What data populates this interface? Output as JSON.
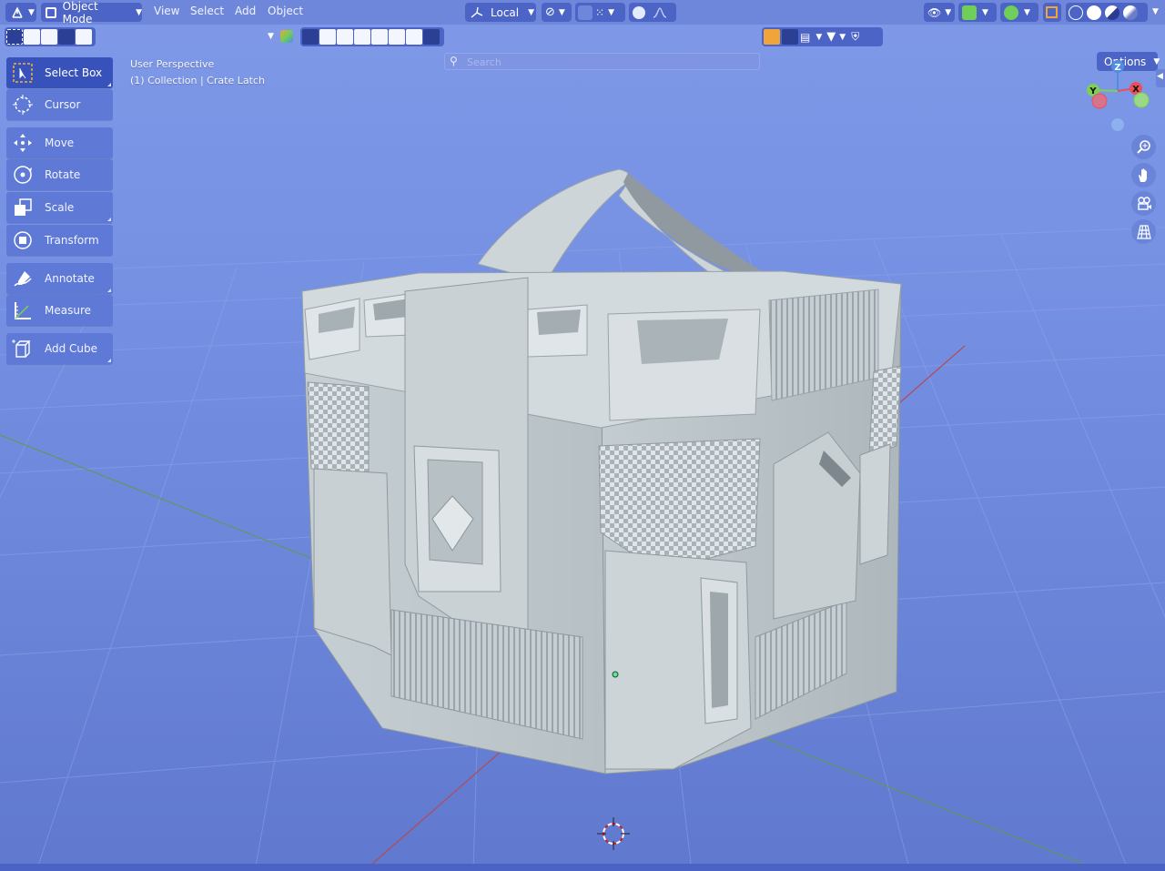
{
  "header": {
    "editor_type_icon": "viewport-axes-icon",
    "mode": "Object Mode",
    "menus": [
      "View",
      "Select",
      "Add",
      "Object"
    ],
    "transform_orientation": "Local",
    "options_label": "Options"
  },
  "toolbar_row": {
    "search_placeholder": "Search"
  },
  "tools": [
    {
      "label": "Select Box",
      "icon": "select-box-icon",
      "active": true
    },
    {
      "label": "Cursor",
      "icon": "cursor-icon"
    },
    {
      "label": "Move",
      "icon": "move-icon"
    },
    {
      "label": "Rotate",
      "icon": "rotate-icon"
    },
    {
      "label": "Scale",
      "icon": "scale-icon"
    },
    {
      "label": "Transform",
      "icon": "transform-icon"
    },
    {
      "label": "Annotate",
      "icon": "annotate-icon"
    },
    {
      "label": "Measure",
      "icon": "measure-icon"
    },
    {
      "label": "Add Cube",
      "icon": "add-cube-icon"
    }
  ],
  "viewport": {
    "perspective_label": "User Perspective",
    "collection_label": "(1) Collection | Crate Latch"
  },
  "gizmo": {
    "axes": [
      "Z",
      "Y",
      "X"
    ],
    "colors": {
      "x": "#e8505a",
      "y": "#7fcf56",
      "z": "#4f8de0"
    }
  },
  "nav_buttons": [
    "zoom-icon",
    "pan-hand-icon",
    "camera-icon",
    "ortho-grid-icon"
  ],
  "colors": {
    "header_bg": "#6f87db",
    "button_bg": "#4b64c6",
    "active_tool": "#3752bb",
    "viewport_bg": "#7590e2"
  }
}
